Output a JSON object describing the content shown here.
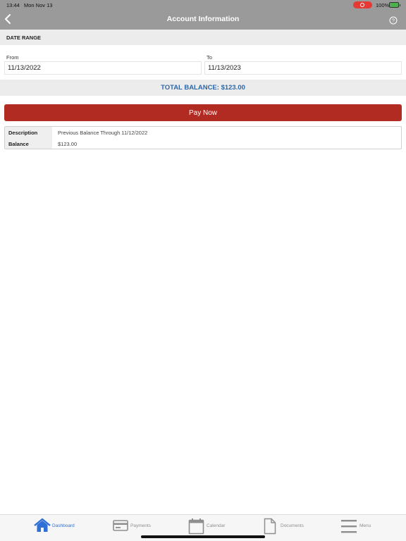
{
  "status_bar": {
    "time": "13:44",
    "date": "Mon Nov 13",
    "battery": "100%"
  },
  "header": {
    "title": "Account Information",
    "back_icon": "chevron-left-icon",
    "help_icon": "question-circle-icon"
  },
  "date_range": {
    "section_label": "DATE RANGE",
    "from_label": "From",
    "from_value": "11/13/2022",
    "to_label": "To",
    "to_value": "11/13/2023"
  },
  "total_balance": "TOTAL BALANCE: $123.00",
  "pay_button": "Pay Now",
  "account_table": {
    "rows": [
      {
        "label": "Description",
        "value": "Previous Balance Through 11/12/2022"
      },
      {
        "label": "Balance",
        "value": "$123.00"
      }
    ]
  },
  "tabbar": {
    "tabs": [
      {
        "label": "Dashboard",
        "icon": "home-icon",
        "active": true
      },
      {
        "label": "Payments",
        "icon": "credit-card-icon",
        "active": false
      },
      {
        "label": "Calendar",
        "icon": "calendar-icon",
        "active": false
      },
      {
        "label": "Documents",
        "icon": "document-icon",
        "active": false
      },
      {
        "label": "Menu",
        "icon": "menu-icon",
        "active": false
      }
    ]
  },
  "colors": {
    "accent": "#2f6fd6",
    "pay_button": "#b22b22",
    "total_text": "#2e67a8",
    "nav_bar": "#9a9a9a"
  }
}
